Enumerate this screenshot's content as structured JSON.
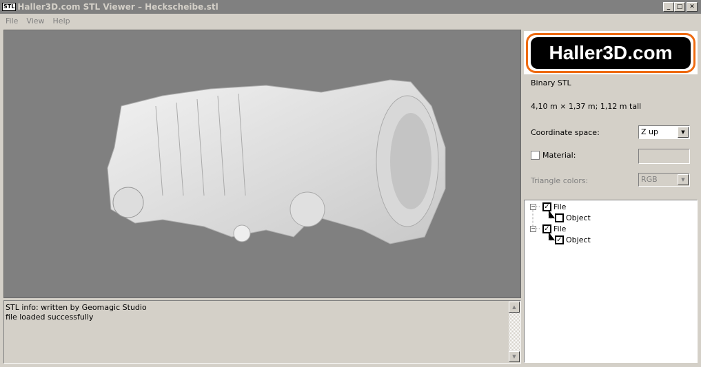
{
  "window": {
    "icon_label": "STL",
    "title": "Haller3D.com STL Viewer – Heckscheibe.stl",
    "minimize": "_",
    "maximize": "□",
    "close": "✕"
  },
  "menu": [
    "File",
    "View",
    "Help"
  ],
  "log": {
    "lines": [
      "STL info: written by Geomagic Studio",
      "file loaded successfully"
    ]
  },
  "panel": {
    "logo_text": "Haller3D.com",
    "format": "Binary STL",
    "dimensions": "4,10 m × 1,37 m;  1,12 m tall",
    "coordinate_space_label": "Coordinate space:",
    "coordinate_space_value": "Z up",
    "material_label": "Material:",
    "material_checked": false,
    "triangle_colors_label": "Triangle colors:",
    "triangle_colors_value": "RGB"
  },
  "tree": [
    {
      "label": "File",
      "checked": true,
      "children": [
        {
          "label": "Object",
          "checked": false
        }
      ]
    },
    {
      "label": "File",
      "checked": true,
      "children": [
        {
          "label": "Object",
          "checked": true
        }
      ]
    }
  ],
  "colors": {
    "accent": "#ee6a10",
    "viewport": "#808080"
  }
}
